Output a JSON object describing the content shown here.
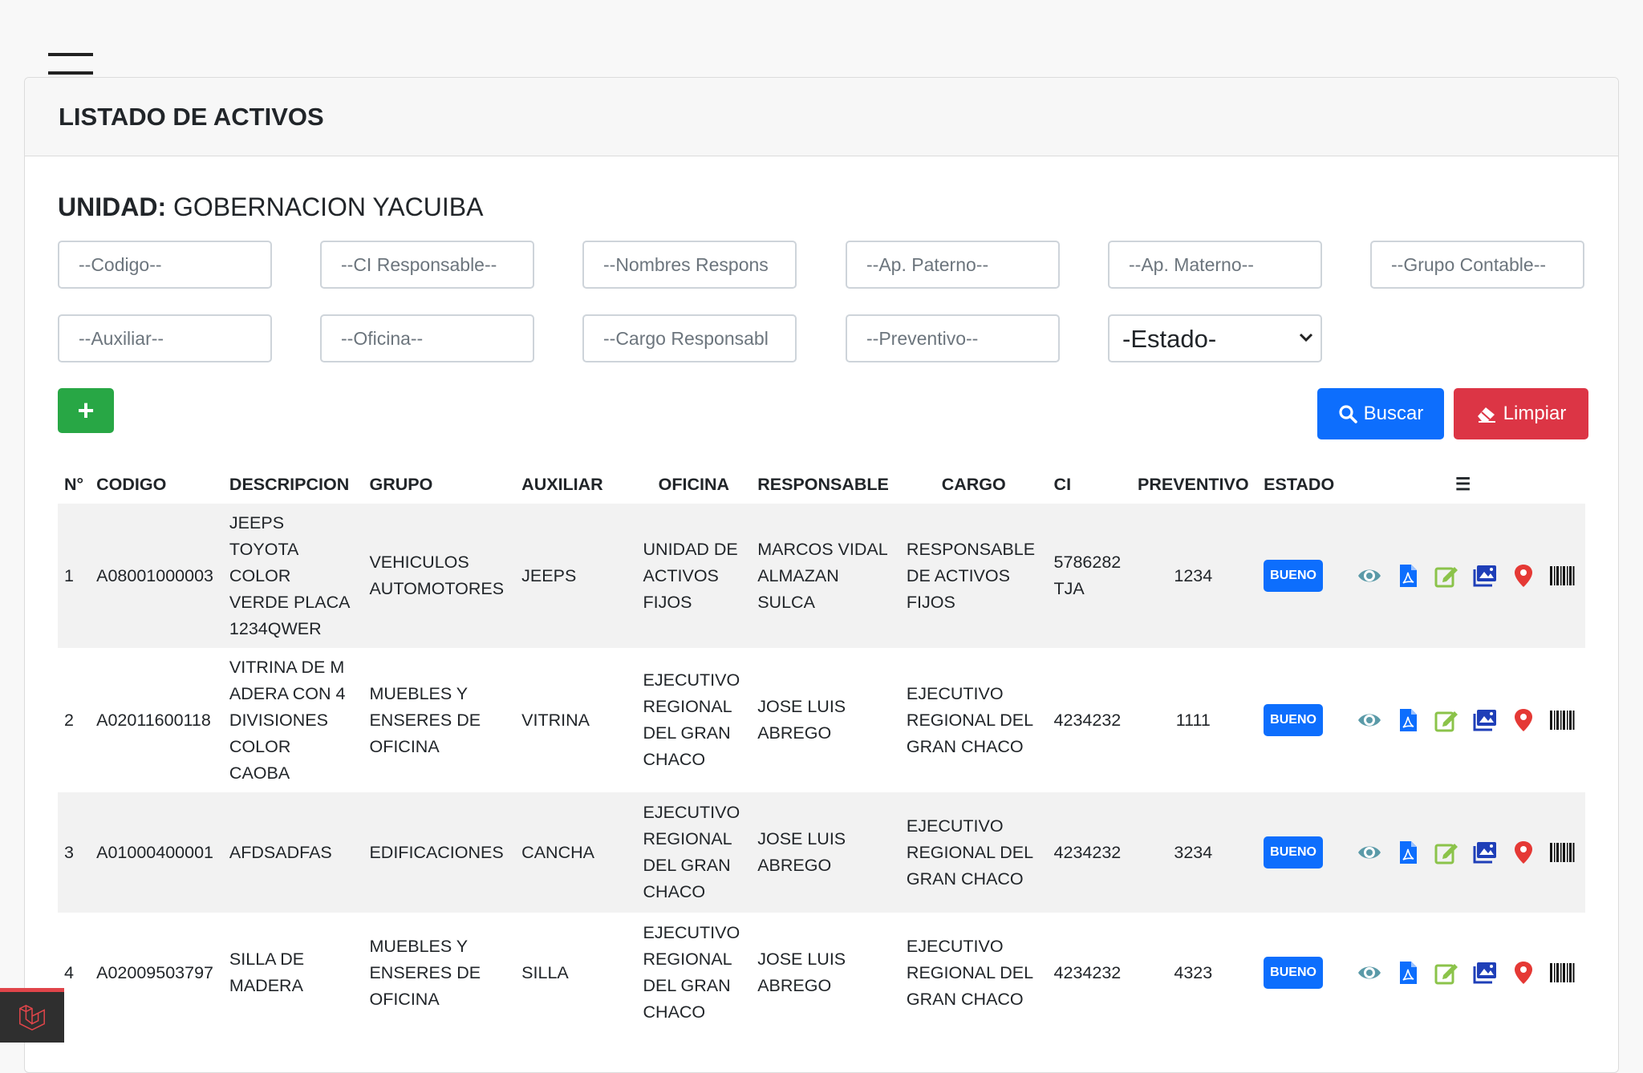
{
  "header": {
    "title": "LISTADO DE ACTIVOS"
  },
  "unidad": {
    "label": "UNIDAD:",
    "value": "GOBERNACION YACUIBA"
  },
  "filters": {
    "codigo": "--Codigo--",
    "ci_responsable": "--CI Responsable--",
    "nombres_responsable": "--Nombres Respons",
    "ap_paterno": "--Ap. Paterno--",
    "ap_materno": "--Ap. Materno--",
    "grupo_contable": "--Grupo Contable--",
    "auxiliar": "--Auxiliar--",
    "oficina": "--Oficina--",
    "cargo_responsable": "--Cargo Responsabl",
    "preventivo": "--Preventivo--",
    "estado": "-Estado-"
  },
  "buttons": {
    "add": "+",
    "buscar": "Buscar",
    "limpiar": "Limpiar"
  },
  "table": {
    "headers": [
      "N°",
      "CODIGO",
      "DESCRIPCION",
      "GRUPO",
      "AUXILIAR",
      "OFICINA",
      "RESPONSABLE",
      "CARGO",
      "CI",
      "PREVENTIVO",
      "ESTADO",
      "☰"
    ],
    "rows": [
      {
        "n": "1",
        "codigo": "A08001000003",
        "descripcion": [
          "JEEPS",
          "TOYOTA",
          "COLOR",
          "VERDE PLACA",
          "1234QWER"
        ],
        "grupo": [
          "VEHICULOS",
          "AUTOMOTORES"
        ],
        "auxiliar": "JEEPS",
        "oficina": [
          "UNIDAD DE",
          "ACTIVOS",
          "FIJOS"
        ],
        "responsable": [
          "MARCOS VIDAL",
          "ALMAZAN",
          "SULCA"
        ],
        "cargo": [
          "RESPONSABLE",
          "DE ACTIVOS",
          "FIJOS"
        ],
        "ci": [
          "5786282",
          "TJA"
        ],
        "preventivo": "1234",
        "estado": "BUENO"
      },
      {
        "n": "2",
        "codigo": "A02011600118",
        "descripcion": [
          "VITRINA DE M",
          "ADERA CON 4",
          "DIVISIONES",
          "COLOR",
          "CAOBA"
        ],
        "grupo": [
          "MUEBLES Y",
          "ENSERES DE",
          "OFICINA"
        ],
        "auxiliar": "VITRINA",
        "oficina": [
          "EJECUTIVO",
          "REGIONAL",
          "DEL GRAN",
          "CHACO"
        ],
        "responsable": [
          "JOSE LUIS",
          "ABREGO"
        ],
        "cargo": [
          "EJECUTIVO",
          "REGIONAL DEL",
          "GRAN CHACO"
        ],
        "ci": [
          "4234232"
        ],
        "preventivo": "1111",
        "estado": "BUENO"
      },
      {
        "n": "3",
        "codigo": "A01000400001",
        "descripcion": [
          "AFDSADFAS"
        ],
        "grupo": [
          "EDIFICACIONES"
        ],
        "auxiliar": "CANCHA",
        "oficina": [
          "EJECUTIVO",
          "REGIONAL",
          "DEL GRAN",
          "CHACO"
        ],
        "responsable": [
          "JOSE LUIS",
          "ABREGO"
        ],
        "cargo": [
          "EJECUTIVO",
          "REGIONAL DEL",
          "GRAN CHACO"
        ],
        "ci": [
          "4234232"
        ],
        "preventivo": "3234",
        "estado": "BUENO"
      },
      {
        "n": "4",
        "codigo": "A02009503797",
        "descripcion": [
          "SILLA DE",
          "MADERA"
        ],
        "grupo": [
          "MUEBLES Y",
          "ENSERES DE",
          "OFICINA"
        ],
        "auxiliar": "SILLA",
        "oficina": [
          "EJECUTIVO",
          "REGIONAL",
          "DEL GRAN",
          "CHACO"
        ],
        "responsable": [
          "JOSE LUIS",
          "ABREGO"
        ],
        "cargo": [
          "EJECUTIVO",
          "REGIONAL DEL",
          "GRAN CHACO"
        ],
        "ci": [
          "4234232"
        ],
        "preventivo": "4323",
        "estado": "BUENO"
      }
    ],
    "row_actions": [
      "view-eye-icon",
      "pdf-icon",
      "edit-icon",
      "image-gallery-icon",
      "map-pin-icon",
      "barcode-icon"
    ]
  },
  "colors": {
    "primary": "#0d6efd",
    "success": "#28a745",
    "danger": "#dc3545",
    "edit": "#8bc34a",
    "pin": "#e53935",
    "eye": "#5a9aa8"
  }
}
